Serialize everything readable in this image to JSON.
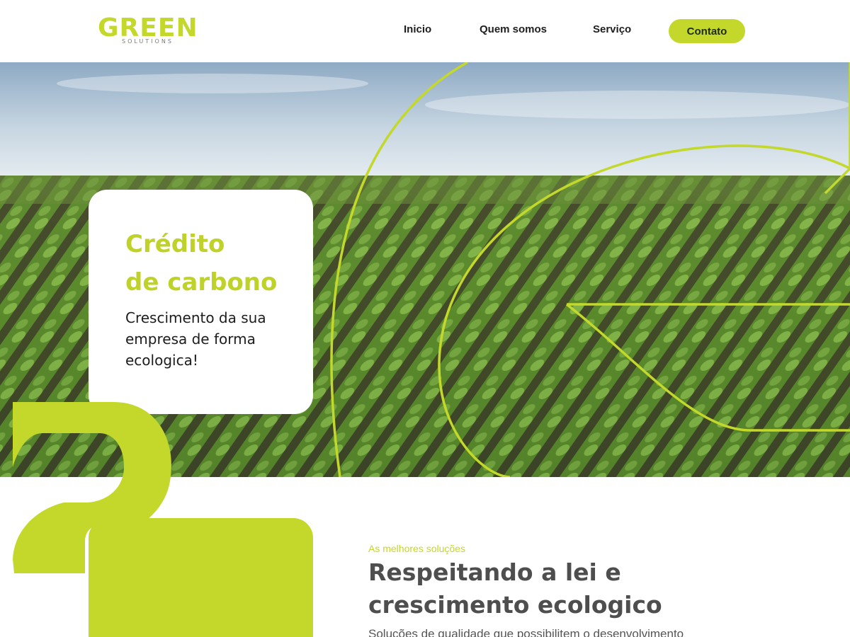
{
  "brand": {
    "logo_word": "GREEN",
    "logo_sub": "SOLUTIONS",
    "accent_color": "#c3d82a"
  },
  "nav": {
    "items": [
      {
        "label": "Inicio"
      },
      {
        "label": "Quem somos"
      },
      {
        "label": "Serviço"
      }
    ],
    "cta_label": "Contato"
  },
  "hero": {
    "title_line1": "Crédito",
    "title_line2": "de carbono",
    "subtitle": "Crescimento da sua empresa de forma ecologica!"
  },
  "section": {
    "eyebrow": "As melhores soluções",
    "title_line1": "Respeitando a lei e",
    "title_line2": "crescimento ecologico",
    "text": "Soluções de qualidade que possibilitem o desenvolvimento"
  }
}
